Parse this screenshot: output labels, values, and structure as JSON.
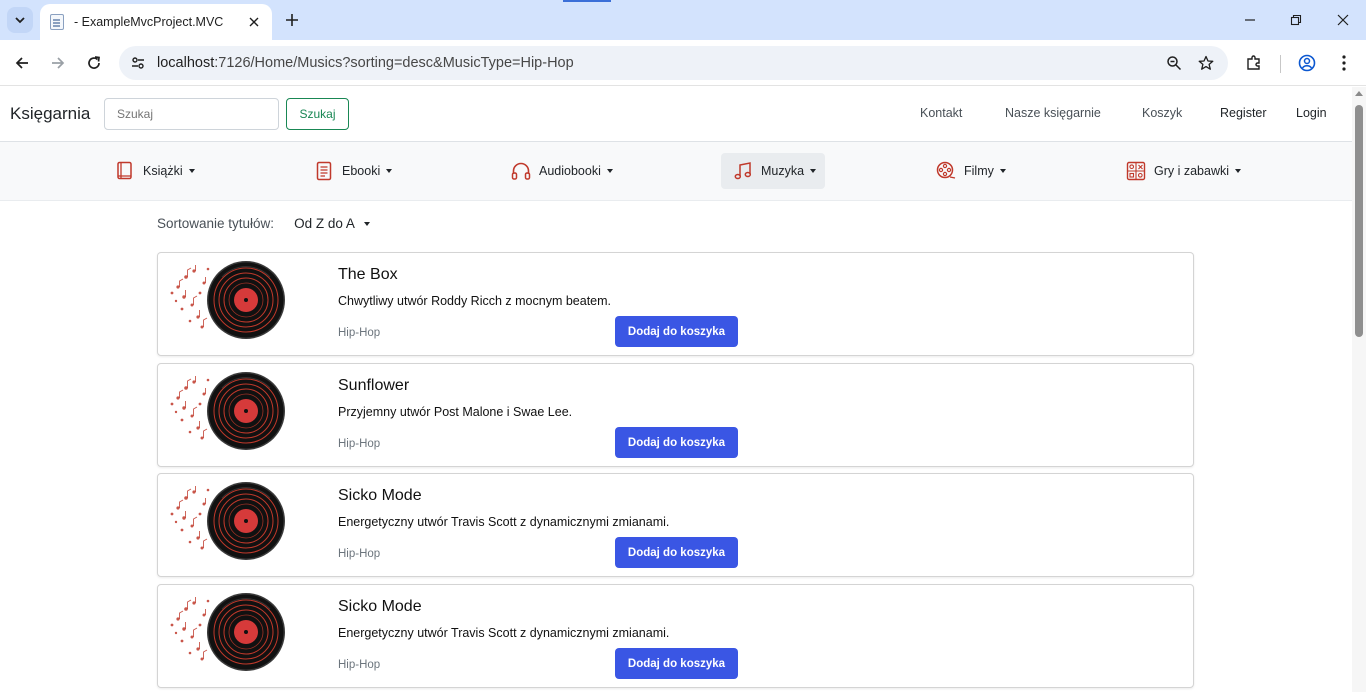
{
  "browser": {
    "tab_title": "- ExampleMvcProject.MVC",
    "url_host": "localhost",
    "url_rest": ":7126/Home/Musics?sorting=desc&MusicType=Hip-Hop"
  },
  "navbar": {
    "brand": "Księgarnia",
    "search_placeholder": "Szukaj",
    "search_button": "Szukaj",
    "links": [
      "Kontakt",
      "Nasze księgarnie",
      "Koszyk",
      "Register",
      "Login"
    ]
  },
  "categories": [
    {
      "label": "Książki",
      "icon": "book-icon"
    },
    {
      "label": "Ebooki",
      "icon": "ebook-icon"
    },
    {
      "label": "Audiobooki",
      "icon": "headphones-icon"
    },
    {
      "label": "Muzyka",
      "icon": "music-note-icon",
      "active": true
    },
    {
      "label": "Filmy",
      "icon": "film-reel-icon"
    },
    {
      "label": "Gry i zabawki",
      "icon": "games-icon"
    }
  ],
  "sorting": {
    "label": "Sortowanie tytułów:",
    "value": "Od Z do A"
  },
  "products": [
    {
      "title": "The Box",
      "description": "Chwytliwy utwór Roddy Ricch z mocnym beatem.",
      "genre": "Hip-Hop",
      "button": "Dodaj do koszyka"
    },
    {
      "title": "Sunflower",
      "description": "Przyjemny utwór Post Malone i Swae Lee.",
      "genre": "Hip-Hop",
      "button": "Dodaj do koszyka"
    },
    {
      "title": "Sicko Mode",
      "description": "Energetyczny utwór Travis Scott z dynamicznymi zmianami.",
      "genre": "Hip-Hop",
      "button": "Dodaj do koszyka"
    },
    {
      "title": "Sicko Mode",
      "description": "Energetyczny utwór Travis Scott z dynamicznymi zmianami.",
      "genre": "Hip-Hop",
      "button": "Dodaj do koszyka"
    }
  ],
  "colors": {
    "accent": "#3a56e4",
    "search_green": "#198754",
    "icon_red": "#c0392b"
  }
}
